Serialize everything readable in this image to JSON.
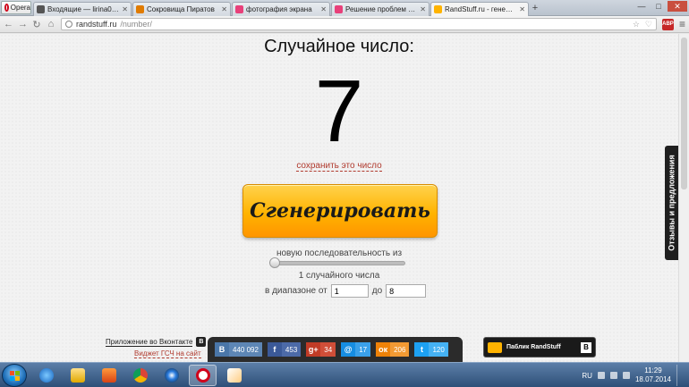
{
  "browser": {
    "menu_label": "Opera",
    "tabs": [
      {
        "title": "Входящие — lirina07@ra",
        "icon": "mail-icon",
        "color": "#555555"
      },
      {
        "title": "Сокровища Пиратов",
        "icon": "pirate-icon",
        "color": "#e07b00"
      },
      {
        "title": "фотография экрана",
        "icon": "vk-icon",
        "color": "#e8407a"
      },
      {
        "title": "Решение проблем - Отв",
        "icon": "answers-icon",
        "color": "#e8407a"
      },
      {
        "title": "RandStuff.ru - генератор",
        "icon": "randstuff-icon",
        "color": "#ffb300"
      }
    ],
    "new_tab_label": "+",
    "url_host": "randstuff.ru",
    "url_path": "/number/",
    "abp_label": "ABP"
  },
  "page": {
    "title": "Случайное число:",
    "number": "7",
    "save_link": "сохранить это число",
    "generate_button": "Сгенерировать",
    "sequence_label": "новую последовательность из",
    "sequence_level": 0,
    "count_label": "1 случайного числа",
    "range_label": "в диапазоне от",
    "range_to_label": "до",
    "range_from": "1",
    "range_to": "8",
    "vk_app_label": "Приложение во Вконтакте",
    "vk_badge": "B",
    "widget_link": "Виджет ГСЧ на сайт",
    "feedback_tab": "Отзывы и предложения",
    "public_label": "Паблик RandStuff",
    "public_badge": "B"
  },
  "shares": [
    {
      "network": "vk",
      "icon_label": "B",
      "count": "440 092",
      "color": "#4a76a8",
      "count_color": "#5d86b5"
    },
    {
      "network": "facebook",
      "icon_label": "f",
      "count": "453",
      "color": "#3b5998",
      "count_color": "#4c6aa8"
    },
    {
      "network": "google-plus",
      "icon_label": "g+",
      "count": "34",
      "color": "#c13b26",
      "count_color": "#d04e38"
    },
    {
      "network": "mail",
      "icon_label": "@",
      "count": "17",
      "color": "#168de2",
      "count_color": "#3aa0ea"
    },
    {
      "network": "odnoklassniki",
      "icon_label": "ок",
      "count": "206",
      "color": "#ee8208",
      "count_color": "#f29a33"
    },
    {
      "network": "twitter",
      "icon_label": "t",
      "count": "120",
      "color": "#1da1f2",
      "count_color": "#45b2f4"
    }
  ],
  "taskbar": {
    "lang": "RU",
    "time": "11:29",
    "date": "18.07.2014"
  }
}
